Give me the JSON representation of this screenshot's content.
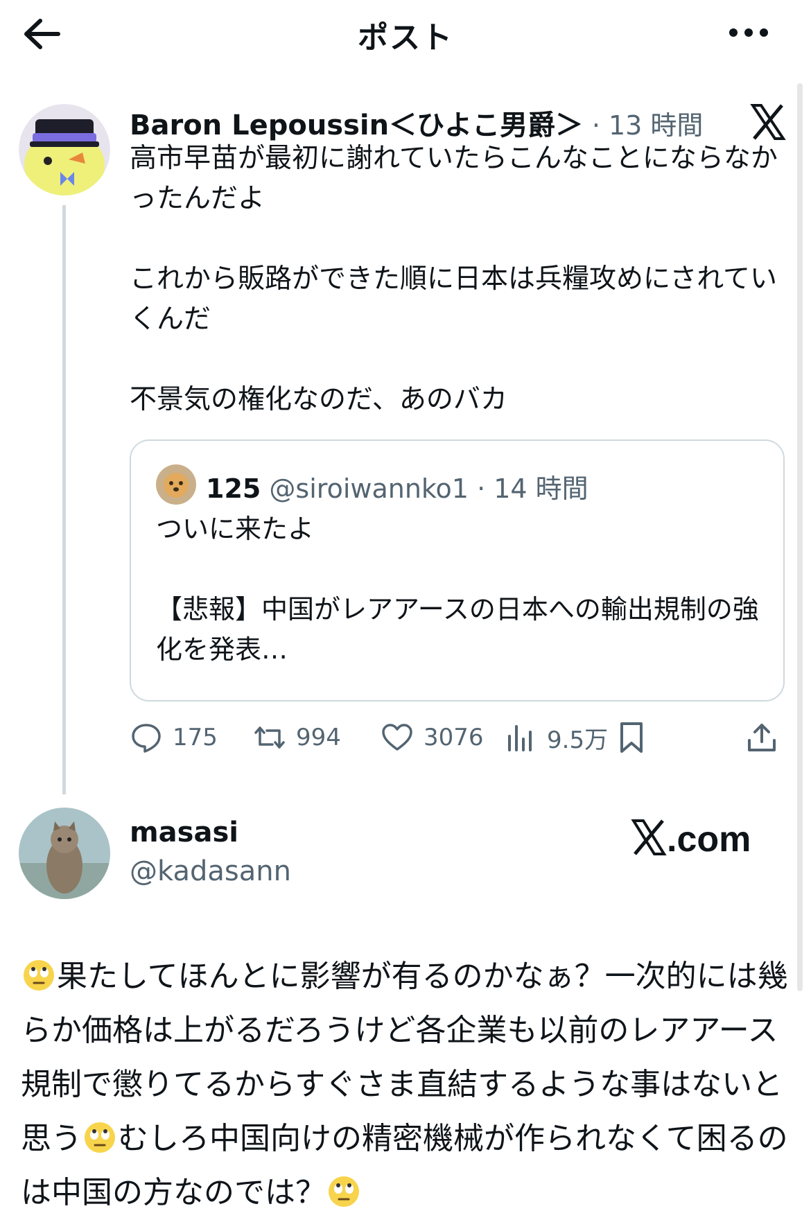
{
  "header": {
    "title": "ポスト"
  },
  "post": {
    "author_name": "Baron Lepoussin＜ひよこ男爵＞",
    "time": "· 13 時間",
    "text": "高市早苗が最初に謝れていたらこんなことにならなかったんだよ\n\nこれから販路ができた順に日本は兵糧攻めにされていくんだ\n\n不景気の権化なのだ、あのバカ",
    "quote": {
      "author_name": "125",
      "handle": "@siroiwannko1",
      "time": "· 14 時間",
      "text": "ついに来たよ\n\n【悲報】中国がレアアースの日本への輸出規制の強化を発表…"
    },
    "actions": {
      "replies": "175",
      "reposts": "994",
      "likes": "3076",
      "views": "9.5万"
    }
  },
  "reply": {
    "author_name": "masasi",
    "handle": "@kadasann",
    "brand": "X.com",
    "segments": [
      "果たしてほんとに影響が有るのかなぁ？一次的には幾らか価格は上がるだろうけど各企業も以前のレアアース規制で懲りてるからすぐさま直結するような事はないと思う",
      "むしろ中国向けの精密機械が作られなくて困るのは中国の方なのでは？"
    ]
  }
}
